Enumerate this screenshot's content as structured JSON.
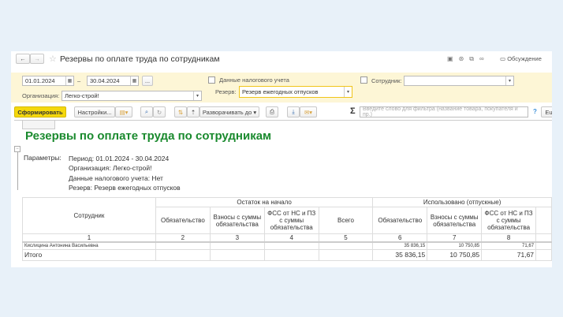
{
  "title": "Резервы по оплате труда по сотрудникам",
  "header_actions": {
    "discussion": "Обсуждение"
  },
  "filters": {
    "date_from": "01.01.2024",
    "dash": "–",
    "date_to": "30.04.2024",
    "more": "...",
    "org_label": "Организация:",
    "org_value": "Легко-строй!",
    "tax_label": "Данные налогового учета",
    "tax_checked": false,
    "reserve_label": "Резерв:",
    "reserve_value": "Резерв ежегодных отпусков",
    "employee_label": "Сотрудник:",
    "employee_value": "",
    "employee_checked": false
  },
  "toolbar": {
    "generate": "Сформировать",
    "settings": "Настройки...",
    "expand": "Разворачивать до",
    "search_placeholder": "Введите слово для фильтра (название товара, покупателя и пр.)",
    "help": "?",
    "extra": "Eu",
    "sigma": "Σ"
  },
  "report": {
    "title": "Резервы по оплате труда по сотрудникам",
    "params_label": "Параметры:",
    "params": [
      "Период: 01.01.2024 - 30.04.2024",
      "Организация: Легко-строй!",
      "Данные налогового учета: Нет",
      "Резерв: Резерв ежегодных отпусков"
    ],
    "table": {
      "employee_header": "Сотрудник",
      "group1": "Остаток на начало",
      "group2": "Использовано (отпускные)",
      "subheaders": [
        "Обязательство",
        "Взносы с суммы обязательства",
        "ФСС от НС и ПЗ с суммы обязательства",
        "Всего",
        "Обязательство",
        "Взносы с суммы обязательства",
        "ФСС от НС и ПЗ с суммы обязательства"
      ],
      "col_numbers": [
        "1",
        "2",
        "3",
        "4",
        "5",
        "6",
        "7",
        "8"
      ],
      "rows": [
        {
          "name": "Кислицина Антонина Васильевна",
          "values": [
            "",
            "",
            "",
            "",
            "35 836,15",
            "10 750,85",
            "71,67"
          ]
        }
      ],
      "total": {
        "name": "Итого",
        "values": [
          "",
          "",
          "",
          "",
          "35 836,15",
          "10 750,85",
          "71,67"
        ]
      }
    }
  }
}
